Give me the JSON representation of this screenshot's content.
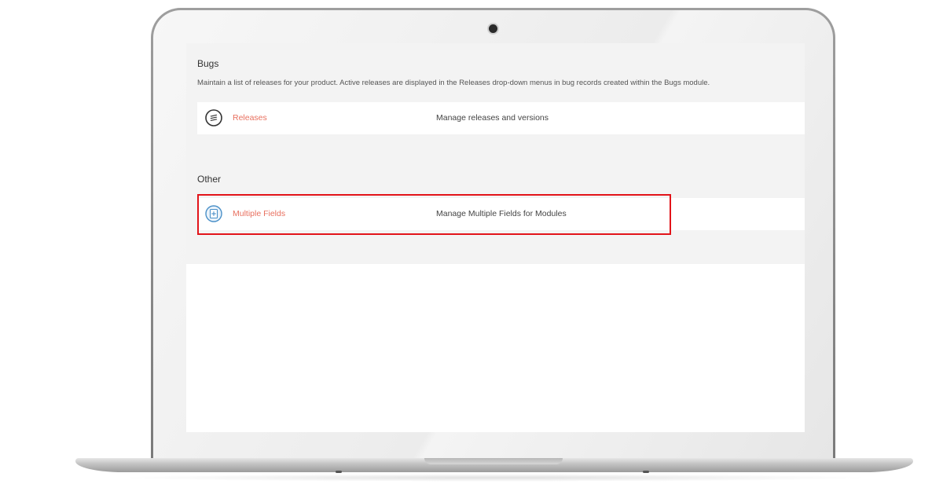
{
  "sections": [
    {
      "title": "Bugs",
      "description": "Maintain a list of releases for your product. Active releases are displayed in the Releases drop-down menus in bug records created within the Bugs module.",
      "items": [
        {
          "label": "Releases",
          "description": "Manage releases and versions",
          "icon": "releases-stack-icon"
        }
      ]
    },
    {
      "title": "Other",
      "items": [
        {
          "label": "Multiple Fields",
          "description": "Manage Multiple Fields for Modules",
          "icon": "multiple-fields-icon",
          "highlighted": true
        }
      ]
    }
  ],
  "colors": {
    "link": "#e8705f",
    "highlight_border": "#e2141a",
    "panel_background": "#f3f3f3",
    "icon_releases": "#333333",
    "icon_multiple_fields": "#4a90c8"
  }
}
